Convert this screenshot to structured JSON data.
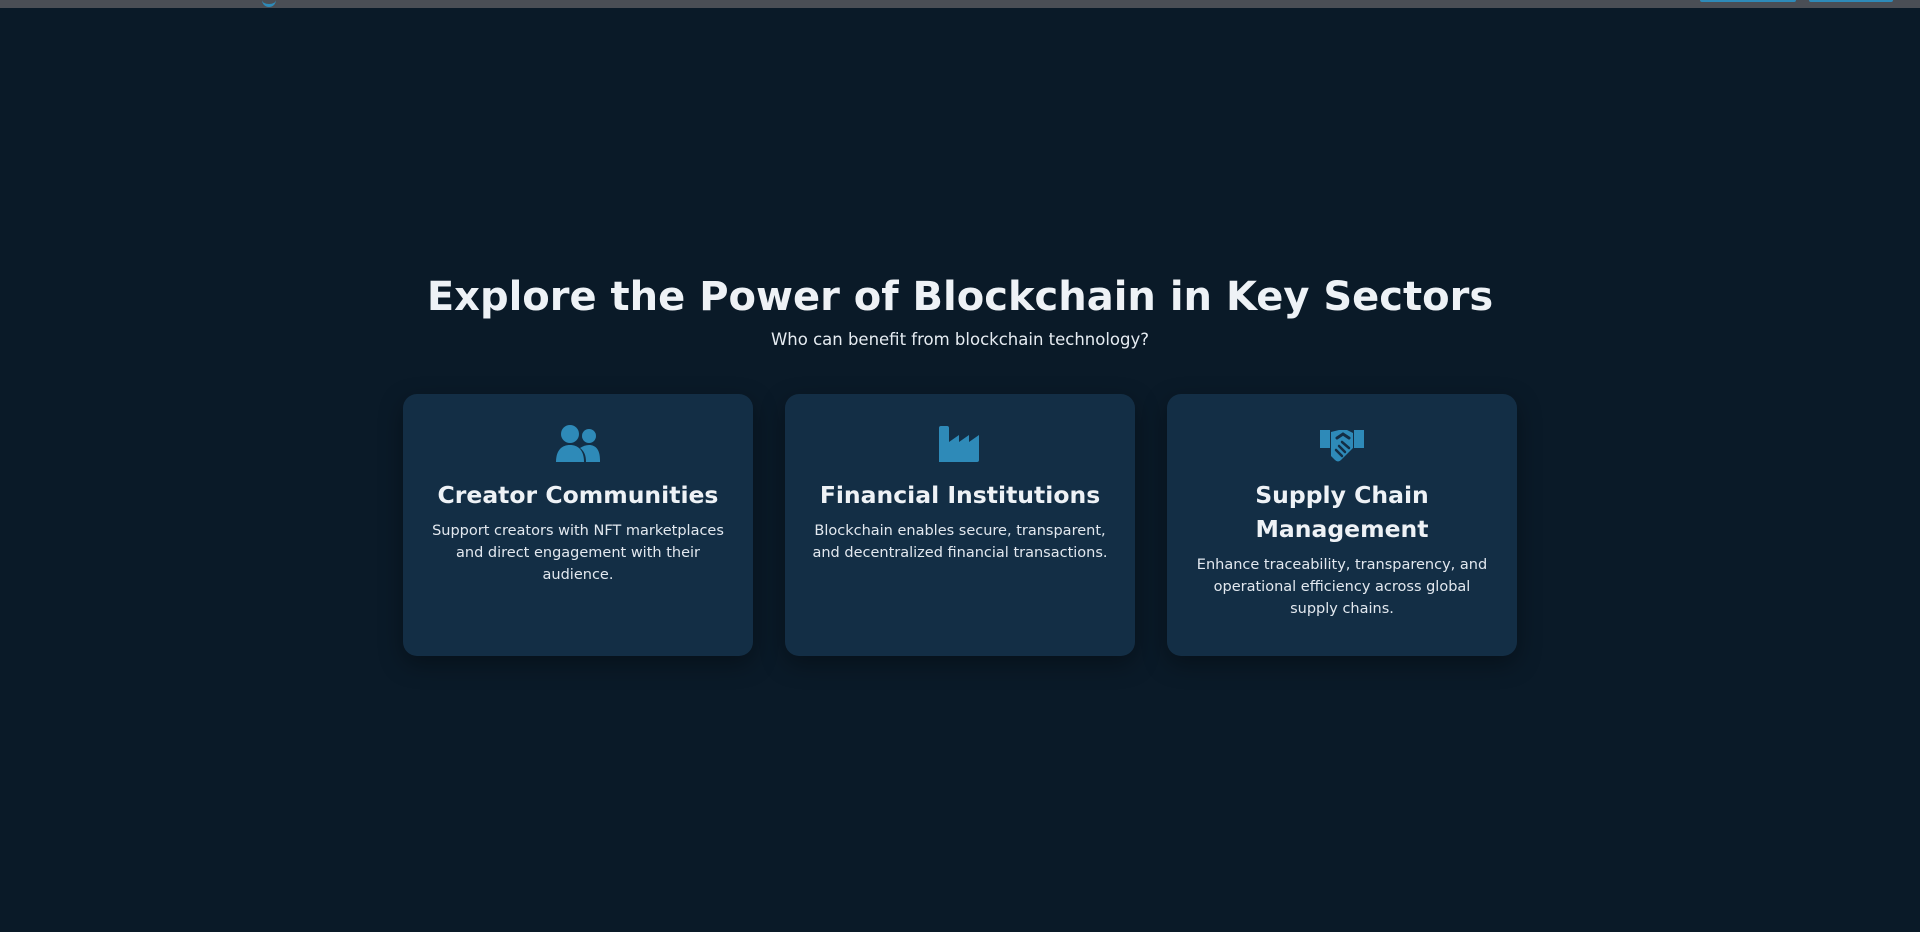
{
  "section": {
    "title": "Explore the Power of Blockchain in Key Sectors",
    "subtitle": "Who can benefit from blockchain technology?"
  },
  "colors": {
    "background": "#0a1a28",
    "card": "#132e45",
    "accent": "#2e8ab8",
    "topbar": "#4a4e55"
  },
  "cards": [
    {
      "icon": "users-icon",
      "title": "Creator Communities",
      "description": "Support creators with NFT marketplaces and direct engagement with their audience."
    },
    {
      "icon": "industry-icon",
      "title": "Financial Institutions",
      "description": "Blockchain enables secure, transparent, and decentralized financial transactions."
    },
    {
      "icon": "handshake-icon",
      "title": "Supply Chain Management",
      "description": "Enhance traceability, transparency, and operational efficiency across global supply chains."
    }
  ]
}
